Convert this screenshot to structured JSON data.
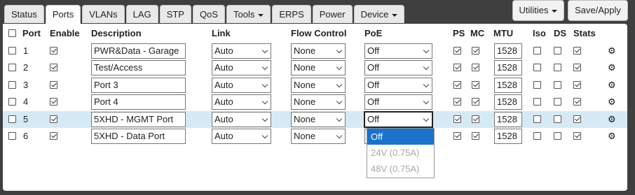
{
  "tabs": [
    {
      "label": "Status",
      "caret": false
    },
    {
      "label": "Ports",
      "caret": false
    },
    {
      "label": "VLANs",
      "caret": false
    },
    {
      "label": "LAG",
      "caret": false
    },
    {
      "label": "STP",
      "caret": false
    },
    {
      "label": "QoS",
      "caret": false
    },
    {
      "label": "Tools",
      "caret": true
    },
    {
      "label": "ERPS",
      "caret": false
    },
    {
      "label": "Power",
      "caret": false
    },
    {
      "label": "Device",
      "caret": true
    }
  ],
  "active_tab": "Ports",
  "toolbar": {
    "utilities_label": "Utilities",
    "save_label": "Save/Apply"
  },
  "columns": {
    "port": "Port",
    "enable": "Enable",
    "description": "Description",
    "link": "Link",
    "flow_control": "Flow Control",
    "poe": "PoE",
    "ps": "PS",
    "mc": "MC",
    "mtu": "MTU",
    "iso": "Iso",
    "ds": "DS",
    "stats": "Stats"
  },
  "select_all_checked": false,
  "rows": [
    {
      "port": "1",
      "selected": false,
      "enable": true,
      "description": "PWR&Data - Garage",
      "link": "Auto",
      "flow": "None",
      "poe": "Off",
      "ps": true,
      "mc": true,
      "mtu": "1528",
      "iso": false,
      "ds": false,
      "stats": true
    },
    {
      "port": "2",
      "selected": false,
      "enable": true,
      "description": "Test/Access",
      "link": "Auto",
      "flow": "None",
      "poe": "Off",
      "ps": true,
      "mc": true,
      "mtu": "1528",
      "iso": false,
      "ds": false,
      "stats": true
    },
    {
      "port": "3",
      "selected": false,
      "enable": true,
      "description": "Port 3",
      "link": "Auto",
      "flow": "None",
      "poe": "Off",
      "ps": true,
      "mc": true,
      "mtu": "1528",
      "iso": false,
      "ds": false,
      "stats": true
    },
    {
      "port": "4",
      "selected": false,
      "enable": true,
      "description": "Port 4",
      "link": "Auto",
      "flow": "None",
      "poe": "Off",
      "ps": true,
      "mc": true,
      "mtu": "1528",
      "iso": false,
      "ds": false,
      "stats": true
    },
    {
      "port": "5",
      "selected": false,
      "enable": true,
      "description": "5XHD - MGMT Port",
      "link": "Auto",
      "flow": "None",
      "poe": "Off",
      "ps": true,
      "mc": true,
      "mtu": "1528",
      "iso": false,
      "ds": false,
      "stats": true,
      "highlighted": true,
      "poe_open": true
    },
    {
      "port": "6",
      "selected": false,
      "enable": true,
      "description": "5XHD - Data Port",
      "link": "Auto",
      "flow": "None",
      "poe": "Off",
      "ps": true,
      "mc": true,
      "mtu": "1528",
      "iso": false,
      "ds": false,
      "stats": true
    }
  ],
  "poe_dropdown": {
    "options": [
      {
        "label": "Off",
        "selected": true,
        "disabled": false
      },
      {
        "label": "24V (0.75A)",
        "selected": false,
        "disabled": true
      },
      {
        "label": "48V (0.75A)",
        "selected": false,
        "disabled": true
      }
    ]
  },
  "icons": {
    "settings": "gear-icon"
  },
  "colors": {
    "highlight_row": "#d6eaf5",
    "selected_option": "#1c71c9",
    "page_bg": "#3f3f3f"
  }
}
